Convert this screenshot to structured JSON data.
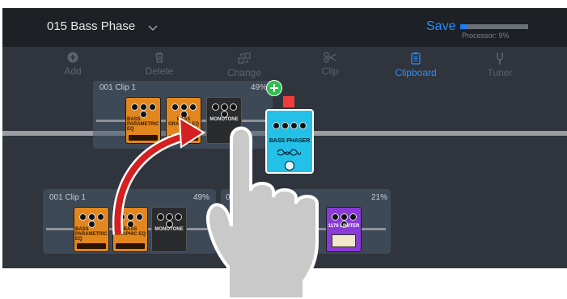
{
  "header": {
    "preset_name": "015 Bass Phase",
    "save_label": "Save",
    "processor_label": "Processor: 9%",
    "processor_fraction": 0.09
  },
  "toolbar": {
    "items": [
      {
        "label": "Add",
        "icon": "plus-circle-icon",
        "active": false
      },
      {
        "label": "Delete",
        "icon": "trash-icon",
        "active": false
      },
      {
        "label": "Change",
        "icon": "swap-icon",
        "active": false
      },
      {
        "label": "Clip",
        "icon": "scissors-icon",
        "active": false
      },
      {
        "label": "Clipboard",
        "icon": "clipboard-icon",
        "active": true
      },
      {
        "label": "Tuner",
        "icon": "tuning-fork-icon",
        "active": false
      }
    ]
  },
  "clipboard_clip": {
    "name": "001  Clip 1",
    "percent": "49%",
    "pedals": [
      {
        "name": "BASS PARAMETRIC EQ"
      },
      {
        "name": "BASS GRAPHIC EQ"
      },
      {
        "name": "MONOTONE"
      }
    ]
  },
  "dragged_pedal": {
    "name": "BASS PHASER"
  },
  "bottom_clips": [
    {
      "name": "001  Clip 1",
      "percent": "49%",
      "pedals": [
        {
          "name": "BASS PARAMETRIC EQ"
        },
        {
          "name": "BASS GRAPHIC EQ"
        },
        {
          "name": "MONOTONE"
        }
      ]
    },
    {
      "name": "00",
      "percent": "21%",
      "pedals": [
        {
          "name": "1176 LIMITER"
        }
      ]
    }
  ],
  "colors": {
    "accent": "#2b8cf6",
    "app_background": "#30353d",
    "header_background": "#1d2025",
    "arrow": "#d42020",
    "hand": "#c9c9c9"
  }
}
